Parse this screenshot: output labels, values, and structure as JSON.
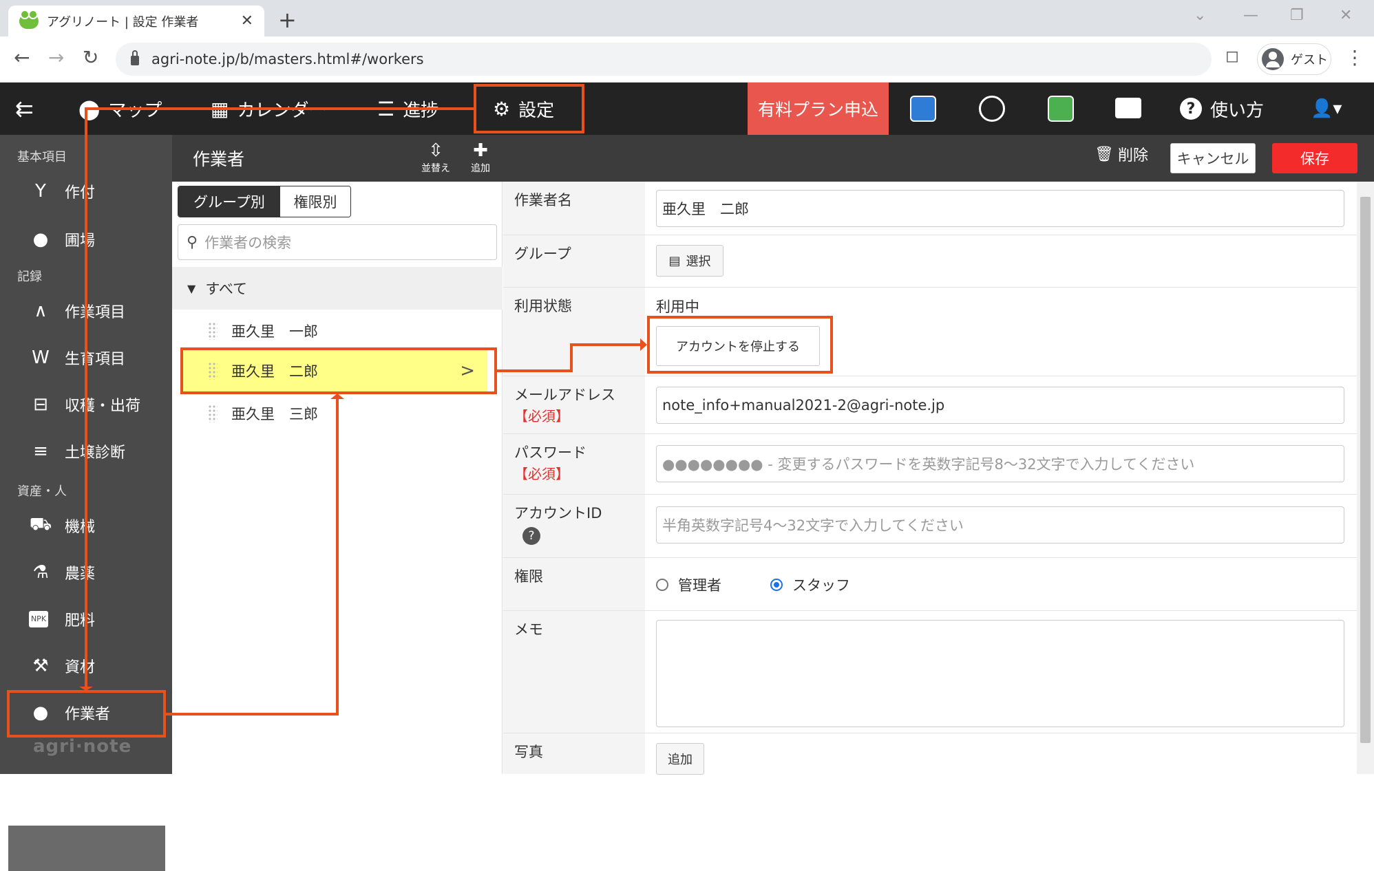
{
  "browser": {
    "tab_title": "アグリノート | 設定 作業者",
    "close_glyph": "✕",
    "new_tab_glyph": "+",
    "url": "agri-note.jp/b/masters.html#/workers",
    "profile_label": "ゲスト",
    "back_glyph": "←",
    "forward_glyph": "→",
    "reload_glyph": "↻",
    "menu_glyph": "⋮"
  },
  "topnav": {
    "menu_glyph": "⇇",
    "items": [
      {
        "label": "マップ",
        "icon": "⬤"
      },
      {
        "label": "カレンダー",
        "icon": "▦"
      },
      {
        "label": "進捗",
        "icon": "☰"
      },
      {
        "label": "設定",
        "icon": "⚙"
      }
    ],
    "plan_button": "有料プラン申込",
    "help_label": "使い方",
    "help_icon": "?"
  },
  "sidebar": {
    "sections": [
      "基本項目",
      "記録",
      "資産・人"
    ],
    "items": [
      {
        "label": "作付",
        "icon": "Y"
      },
      {
        "label": "圃場",
        "icon": "●"
      },
      {
        "label": "作業項目",
        "icon": "∧"
      },
      {
        "label": "生育項目",
        "icon": "W"
      },
      {
        "label": "収穫・出荷",
        "icon": "⊟"
      },
      {
        "label": "土壌診断",
        "icon": "≡"
      },
      {
        "label": "機械",
        "icon": "⛟"
      },
      {
        "label": "農薬",
        "icon": "⚗"
      },
      {
        "label": "肥料",
        "icon": "NPK"
      },
      {
        "label": "資材",
        "icon": "⚒"
      },
      {
        "label": "作業者",
        "icon": "●"
      }
    ],
    "logo": "agri·note"
  },
  "subheader": {
    "title": "作業者",
    "sort_label": "並替え",
    "add_label": "追加",
    "delete_label": "削除",
    "cancel_label": "キャンセル",
    "save_label": "保存"
  },
  "list": {
    "tab_group": "グループ別",
    "tab_role": "権限別",
    "search_placeholder": "作業者の検索",
    "all_label": "すべて",
    "workers": [
      "亜久里　一郎",
      "亜久里　二郎",
      "亜久里　三郎"
    ]
  },
  "form": {
    "name_label": "作業者名",
    "name_value": "亜久里　二郎",
    "group_label": "グループ",
    "group_button": "選択",
    "status_label": "利用状態",
    "status_value": "利用中",
    "stop_button": "アカウントを停止する",
    "email_label": "メールアドレス",
    "required_label": "【必須】",
    "email_value": "note_info+manual2021-2@agri-note.jp",
    "password_label": "パスワード",
    "password_placeholder": "●●●●●●●● - 変更するパスワードを英数字記号8～32文字で入力してください",
    "account_label": "アカウントID",
    "account_placeholder": "半角英数字記号4～32文字で入力してください",
    "role_label": "権限",
    "role_admin": "管理者",
    "role_staff": "スタッフ",
    "memo_label": "メモ",
    "photo_label": "写真",
    "photo_button": "追加"
  },
  "colors": {
    "annotation": "#e8501e",
    "plan": "#e8564d",
    "save": "#f42b2b",
    "selected_row": "#ffff88"
  }
}
